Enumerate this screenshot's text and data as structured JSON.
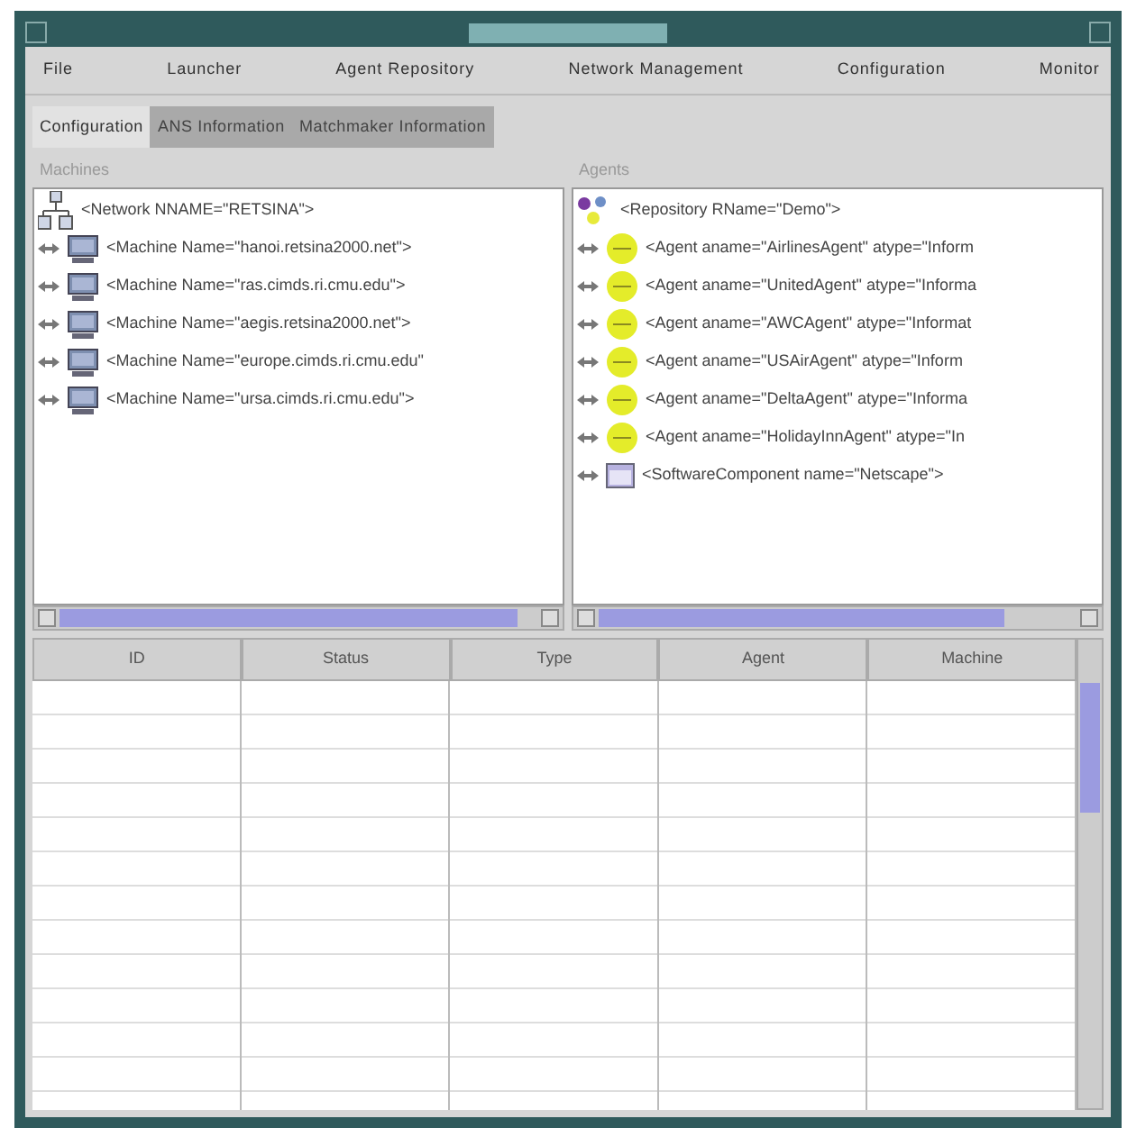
{
  "menu": [
    "File",
    "Launcher",
    "Agent Repository",
    "Network Management",
    "Configuration",
    "Monitor"
  ],
  "tabs": [
    {
      "label": "Configuration",
      "selected": true
    },
    {
      "label": "ANS Information",
      "selected": false
    },
    {
      "label": "Matchmaker Information",
      "selected": false
    }
  ],
  "machines_panel": {
    "title": "Machines",
    "items": [
      {
        "kind": "network",
        "text": "<Network NNAME=\"RETSINA\">"
      },
      {
        "kind": "machine",
        "text": "<Machine Name=\"hanoi.retsina2000.net\">"
      },
      {
        "kind": "machine",
        "text": "<Machine Name=\"ras.cimds.ri.cmu.edu\">"
      },
      {
        "kind": "machine",
        "text": "<Machine Name=\"aegis.retsina2000.net\">"
      },
      {
        "kind": "machine",
        "text": "<Machine Name=\"europe.cimds.ri.cmu.edu\""
      },
      {
        "kind": "machine",
        "text": "<Machine Name=\"ursa.cimds.ri.cmu.edu\">"
      }
    ]
  },
  "agents_panel": {
    "title": "Agents",
    "items": [
      {
        "kind": "repository",
        "text": "<Repository RName=\"Demo\">"
      },
      {
        "kind": "agent",
        "text": "<Agent aname=\"AirlinesAgent\" atype=\"Inform"
      },
      {
        "kind": "agent",
        "text": "<Agent aname=\"UnitedAgent\" atype=\"Informa"
      },
      {
        "kind": "agent",
        "text": "<Agent aname=\"AWCAgent\" atype=\"Informat"
      },
      {
        "kind": "agent",
        "text": "<Agent aname=\"USAirAgent\" atype=\"Inform"
      },
      {
        "kind": "agent",
        "text": "<Agent aname=\"DeltaAgent\" atype=\"Informa"
      },
      {
        "kind": "agent",
        "text": "<Agent aname=\"HolidayInnAgent\" atype=\"In"
      },
      {
        "kind": "component",
        "text": "<SoftwareComponent name=\"Netscape\">"
      }
    ]
  },
  "table": {
    "columns": [
      "ID",
      "Status",
      "Type",
      "Agent",
      "Machine"
    ]
  }
}
